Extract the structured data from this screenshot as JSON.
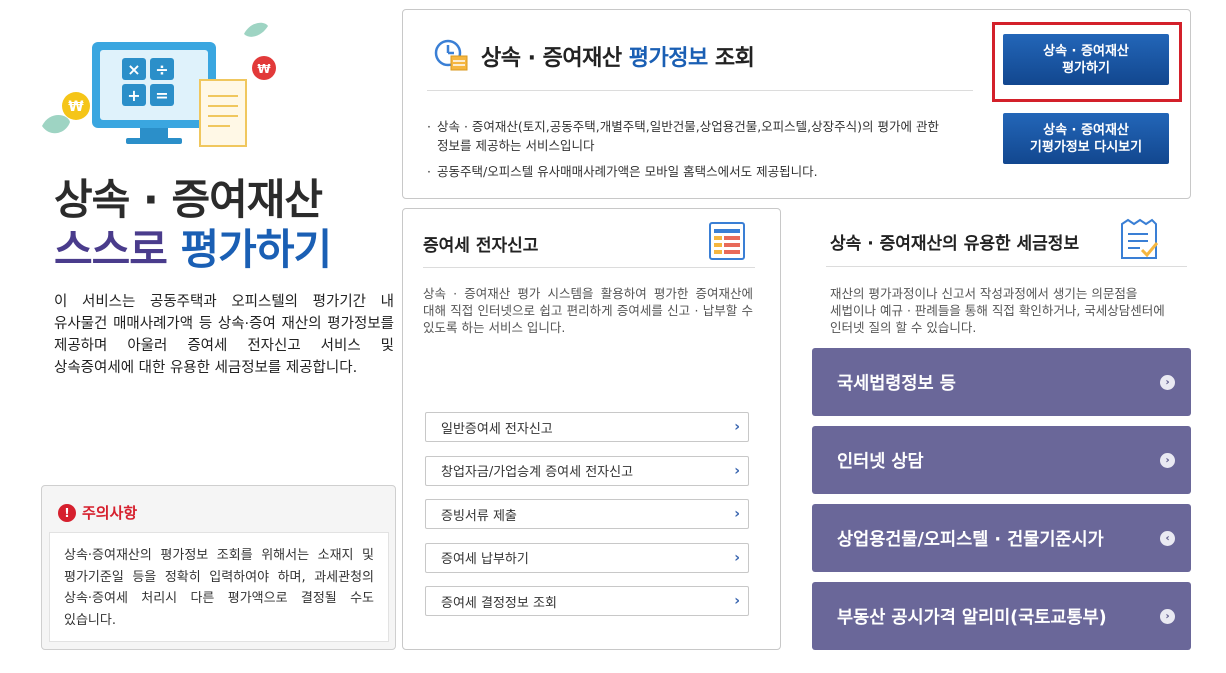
{
  "hero": {
    "title_line1": "상속 · 증여재산",
    "title_line2a": "스스로 ",
    "title_line2b": "평가하기",
    "description": "이 서비스는 공동주택과 오피스텔의 평가기간 내 유사물건 매매사례가액 등 상속·증여 재산의 평가정보를 제공하며 아울러 증여세 전자신고 서비스 및 상속증여세에 대한 유용한 세금정보를 제공합니다."
  },
  "notice": {
    "icon_glyph": "!",
    "title": "주의사항",
    "text": "상속·증여재산의 평가정보 조회를 위해서는 소재지 및 평가기준일 등을 정확히 입력하여야 하며, 과세관청의 상속·증여세 처리시 다른 평가액으로 결정될 수도 있습니다."
  },
  "top_panel": {
    "title_pre": "상속 · 증여재산 ",
    "title_hl": "평가정보",
    "title_post": " 조회",
    "bullets": [
      "상속 · 증여재산(토지,공동주택,개별주택,일반건물,상업용건물,오피스텔,상장주식)의 평가에 관한 정보를 제공하는 서비스입니다",
      "공동주택/오피스텔 유사매매사례가액은 모바일 홈택스에서도 제공됩니다."
    ],
    "eval_button_line1": "상속 · 증여재산",
    "eval_button_line2": "평가하기",
    "review_button_line1": "상속 · 증여재산",
    "review_button_line2": "기평가정보 다시보기"
  },
  "gift_tax": {
    "title": "증여세 전자신고",
    "description": "상속 · 증여재산 평가 시스템을 활용하여 평가한 증여재산에 대해 직접 인터넷으로 쉽고 편리하게 증여세를 신고 · 납부할 수 있도록 하는 서비스 입니다.",
    "links": [
      {
        "label": "일반증여세 전자신고"
      },
      {
        "label": "창업자금/가업승계 증여세 전자신고"
      },
      {
        "label": "증빙서류 제출"
      },
      {
        "label": "증여세 납부하기"
      },
      {
        "label": "증여세 결정정보 조회"
      }
    ],
    "chevron": "›"
  },
  "tax_info": {
    "title": "상속 · 증여재산의 유용한 세금정보",
    "description": "재산의 평가과정이나 신고서 작성과정에서 생기는 의문점을 세법이나 예규 · 판례들을 통해 직접 확인하거나, 국세상담센터에 인터넷 질의 할 수 있습니다.",
    "buttons": [
      {
        "label": "국세법령정보 등",
        "arrow": "›"
      },
      {
        "label": "인터넷 상담",
        "arrow": "›"
      },
      {
        "label": "상업용건물/오피스텔 · 건물기준시가",
        "arrow": "‹"
      },
      {
        "label": "부동산 공시가격 알리미(국토교통부)",
        "arrow": "›"
      }
    ]
  },
  "colors": {
    "accent_blue": "#1a5fb4",
    "purple_button": "#6a6799",
    "highlight_red": "#d3202a"
  }
}
